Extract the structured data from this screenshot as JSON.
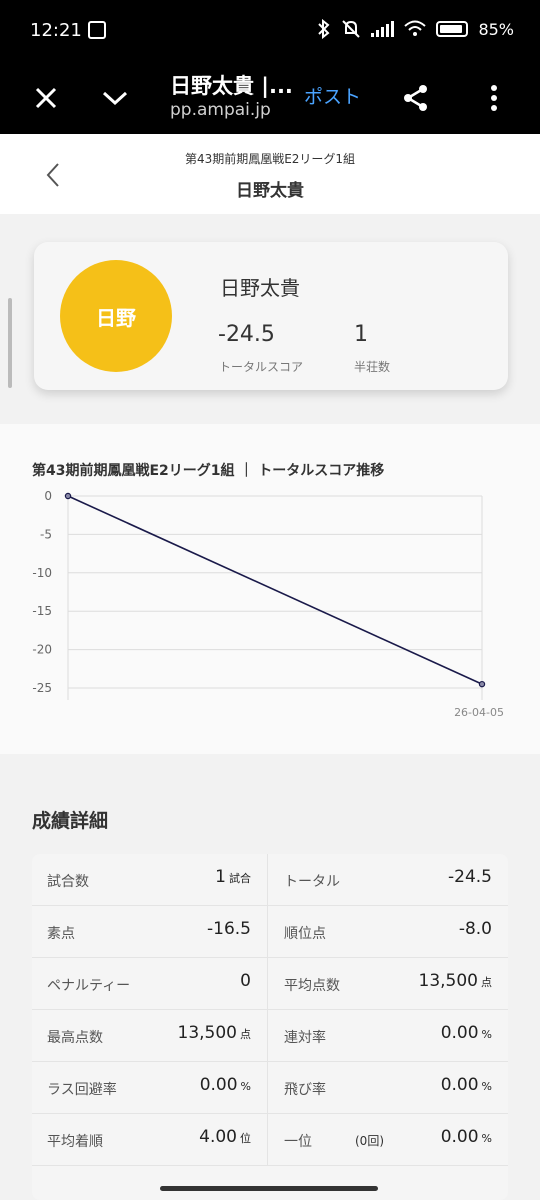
{
  "status": {
    "time": "12:21",
    "battery": "85%"
  },
  "browser": {
    "title": "日野太貴 |...",
    "url": "pp.ampai.jp",
    "post_label": "ポスト"
  },
  "header": {
    "subtitle": "第43期前期鳳凰戦E2リーグ1組",
    "title": "日野太貴"
  },
  "profile": {
    "avatar_text": "日野",
    "avatar_color": "#f5c018",
    "name": "日野太貴",
    "total_score": "-24.5",
    "total_score_label": "トータルスコア",
    "games": "1",
    "games_label": "半荘数"
  },
  "chart_data": {
    "type": "line",
    "title": "第43期前期鳳凰戦E2リーグ1組 ｜ トータルスコア推移",
    "x_labels": [
      "",
      "26-04-05"
    ],
    "series": [
      {
        "values": [
          0,
          -24.5
        ],
        "color": "#1a1a4a"
      }
    ],
    "y_ticks": [
      0,
      -5,
      -10,
      -15,
      -20,
      -25
    ],
    "ylim": [
      -25,
      0
    ],
    "grid": true
  },
  "details": {
    "title": "成績詳細",
    "rows": [
      {
        "left": {
          "label": "試合数",
          "value": "1",
          "unit": "試合"
        },
        "right": {
          "label": "トータル",
          "value": "-24.5",
          "unit": ""
        }
      },
      {
        "left": {
          "label": "素点",
          "value": "-16.5",
          "unit": ""
        },
        "right": {
          "label": "順位点",
          "value": "-8.0",
          "unit": ""
        }
      },
      {
        "left": {
          "label": "ペナルティー",
          "value": "0",
          "unit": ""
        },
        "right": {
          "label": "平均点数",
          "value": "13,500",
          "unit": "点"
        }
      },
      {
        "left": {
          "label": "最高点数",
          "value": "13,500",
          "unit": "点"
        },
        "right": {
          "label": "連対率",
          "value": "0.00",
          "unit": "%"
        }
      },
      {
        "left": {
          "label": "ラス回避率",
          "value": "0.00",
          "unit": "%"
        },
        "right": {
          "label": "飛び率",
          "value": "0.00",
          "unit": "%"
        }
      },
      {
        "left": {
          "label": "平均着順",
          "value": "4.00",
          "unit": "位"
        },
        "right": {
          "label": "一位",
          "extra": "(0回)",
          "value": "0.00",
          "unit": "%"
        }
      }
    ]
  }
}
